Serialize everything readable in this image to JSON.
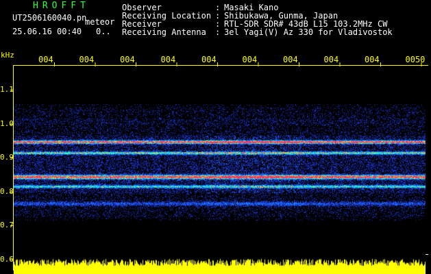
{
  "header": {
    "app_name": "HROFFT",
    "filename": "UT2506160040.pn",
    "mode": "meteor",
    "timestamp": "25.06.16 00:40",
    "extra": "0..",
    "fields": [
      {
        "label": "Observer",
        "value": "Masaki Kano"
      },
      {
        "label": "Receiving Location",
        "value": "Shibukawa, Gunma, Japan"
      },
      {
        "label": "Receiver",
        "value": "RTL-SDR SDR# 43dB L15 103.2MHz CW"
      },
      {
        "label": "Receiving Antenna",
        "value": "3el Yagi(V) Az 330 for Vladivostok"
      }
    ],
    "separator": ":"
  },
  "axis": {
    "unit": "kHz",
    "y_ticks": [
      "1.1",
      "1.0",
      "0.9",
      "0.8",
      "0.7",
      "0.6"
    ],
    "time_ticks": [
      "004",
      "004",
      "004",
      "004",
      "004",
      "004",
      "004",
      "004",
      "004",
      "0050"
    ]
  },
  "colors": {
    "background": "#000000",
    "text": "#ffffff",
    "title": "#33ff33",
    "axis": "#ffff00",
    "signal_low": "#1a3cff",
    "signal_mid": "#00ffcc",
    "signal_high": "#ff3366"
  }
}
